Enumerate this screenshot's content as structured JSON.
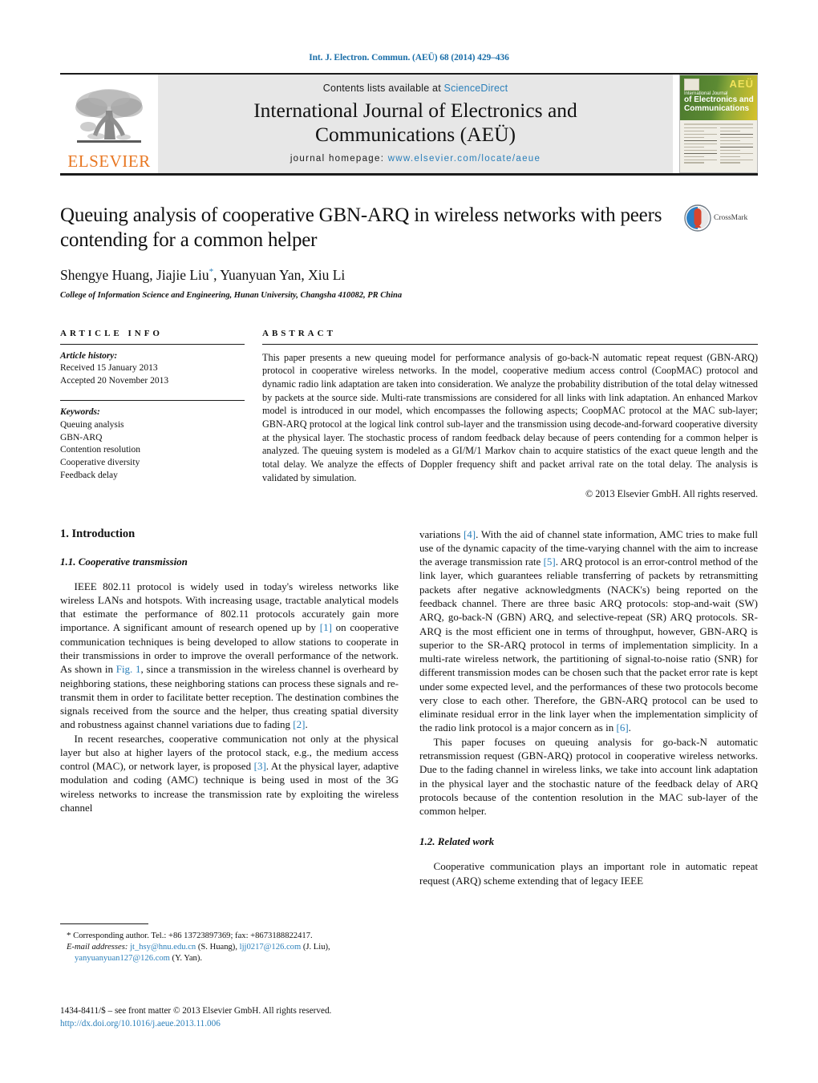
{
  "running_head": "Int. J. Electron. Commun. (AEÜ) 68 (2014) 429–436",
  "masthead": {
    "publisher": "ELSEVIER",
    "contents_prefix": "Contents lists available at ",
    "contents_link": "ScienceDirect",
    "journal_title_line1": "International Journal of Electronics and",
    "journal_title_line2": "Communications (AEÜ)",
    "homepage_label": "journal homepage:",
    "homepage_url": "www.elsevier.com/locate/aeue",
    "cover": {
      "aeu": "AEÜ",
      "intl_journal": "International Journal",
      "name_line1": "of Electronics and",
      "name_line2": "Communications"
    }
  },
  "article": {
    "title": "Queuing analysis of cooperative GBN-ARQ in wireless networks with peers contending for a common helper",
    "authors": "Shengye Huang, Jiajie Liu",
    "authors_star": "*",
    "authors_rest": ", Yuanyuan Yan, Xiu Li",
    "affiliation": "College of Information Science and Engineering, Hunan University, Changsha 410082, PR China",
    "crossmark_label": "CrossMark"
  },
  "article_info": {
    "heading": "ARTICLE INFO",
    "history_label": "Article history:",
    "received": "Received 15 January 2013",
    "accepted": "Accepted 20 November 2013",
    "keywords_label": "Keywords:",
    "keywords": [
      "Queuing analysis",
      "GBN-ARQ",
      "Contention resolution",
      "Cooperative diversity",
      "Feedback delay"
    ]
  },
  "abstract": {
    "heading": "ABSTRACT",
    "text": "This paper presents a new queuing model for performance analysis of go-back-N automatic repeat request (GBN-ARQ) protocol in cooperative wireless networks. In the model, cooperative medium access control (CoopMAC) protocol and dynamic radio link adaptation are taken into consideration. We analyze the probability distribution of the total delay witnessed by packets at the source side. Multi-rate transmissions are considered for all links with link adaptation. An enhanced Markov model is introduced in our model, which encompasses the following aspects; CoopMAC protocol at the MAC sub-layer; GBN-ARQ protocol at the logical link control sub-layer and the transmission using decode-and-forward cooperative diversity at the physical layer. The stochastic process of random feedback delay because of peers contending for a common helper is analyzed. The queuing system is modeled as a GI/M/1 Markov chain to acquire statistics of the exact queue length and the total delay. We analyze the effects of Doppler frequency shift and packet arrival rate on the total delay. The analysis is validated by simulation.",
    "copyright": "© 2013 Elsevier GmbH. All rights reserved."
  },
  "body": {
    "section1_heading": "1.  Introduction",
    "subsection11_heading": "1.1.  Cooperative transmission",
    "left_para1_a": "IEEE 802.11 protocol is widely used in today's wireless networks like wireless LANs and hotspots. With increasing usage, tractable analytical models that estimate the performance of 802.11 protocols accurately gain more importance. A significant amount of research opened up by ",
    "left_para1_ref1": "[1]",
    "left_para1_b": " on cooperative communication techniques is being developed to allow stations to cooperate in their transmissions in order to improve the overall performance of the network. As shown in ",
    "left_para1_fig": "Fig. 1",
    "left_para1_c": ", since a transmission in the wireless channel is overheard by neighboring stations, these neighboring stations can process these signals and re-transmit them in order to facilitate better reception. The destination combines the signals received from the source and the helper, thus creating spatial diversity and robustness against channel variations due to fading ",
    "left_para1_ref2": "[2]",
    "left_para1_d": ".",
    "left_para2_a": "In recent researches, cooperative communication not only at the physical layer but also at higher layers of the protocol stack, e.g., the medium access control (MAC), or network layer, is proposed ",
    "left_para2_ref3": "[3]",
    "left_para2_b": ". At the physical layer, adaptive modulation and coding (AMC) technique is being used in most of the 3G wireless networks to increase the transmission rate by exploiting the wireless channel",
    "right_para1_a": "variations ",
    "right_para1_ref4": "[4]",
    "right_para1_b": ". With the aid of channel state information, AMC tries to make full use of the dynamic capacity of the time-varying channel with the aim to increase the average transmission rate ",
    "right_para1_ref5": "[5]",
    "right_para1_c": ". ARQ protocol is an error-control method of the link layer, which guarantees reliable transferring of packets by retransmitting packets after negative acknowledgments (NACK's) being reported on the feedback channel. There are three basic ARQ protocols: stop-and-wait (SW) ARQ, go-back-N (GBN) ARQ, and selective-repeat (SR) ARQ protocols. SR-ARQ is the most efficient one in terms of throughput, however, GBN-ARQ is superior to the SR-ARQ protocol in terms of implementation simplicity. In a multi-rate wireless network, the partitioning of signal-to-noise ratio (SNR) for different transmission modes can be chosen such that the packet error rate is kept under some expected level, and the performances of these two protocols become very close to each other. Therefore, the GBN-ARQ protocol can be used to eliminate residual error in the link layer when the implementation simplicity of the radio link protocol is a major concern as in ",
    "right_para1_ref6": "[6]",
    "right_para1_d": ".",
    "right_para2": "This paper focuses on queuing analysis for go-back-N automatic retransmission request (GBN-ARQ) protocol in cooperative wireless networks. Due to the fading channel in wireless links, we take into account link adaptation in the physical layer and the stochastic nature of the feedback delay of ARQ protocols because of the contention resolution in the MAC sub-layer of the common helper.",
    "subsection12_heading": "1.2.  Related work",
    "right_para3": "Cooperative communication plays an important role in automatic repeat request (ARQ) scheme extending that of legacy IEEE"
  },
  "footnotes": {
    "star": "*",
    "corresponding": " Corresponding author. Tel.: +86 13723897369; fax: +8673188822417.",
    "email_label": "E-mail addresses:",
    "email1": "jt_hsy@hnu.edu.cn",
    "email1_name": " (S. Huang), ",
    "email2": "ljj0217@126.com",
    "email2_name": " (J. Liu), ",
    "email3": "yanyuanyuan127@126.com",
    "email3_name": " (Y. Yan)."
  },
  "issn": {
    "line1": "1434-8411/$ – see front matter © 2013 Elsevier GmbH. All rights reserved.",
    "doi": "http://dx.doi.org/10.1016/j.aeue.2013.11.006"
  }
}
